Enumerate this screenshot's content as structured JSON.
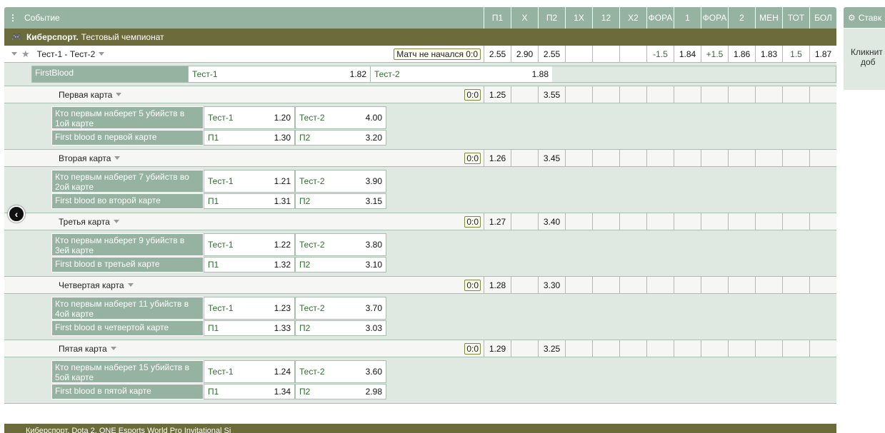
{
  "header": {
    "event_label": "Событие",
    "columns": [
      "П1",
      "X",
      "П2",
      "1X",
      "12",
      "X2",
      "ФОРА",
      "1",
      "ФОРА",
      "2",
      "МЕН",
      "ТОТ",
      "БОЛ"
    ]
  },
  "sport": {
    "name": "Киберспорт.",
    "championship": "Тестовый чемпионат"
  },
  "match": {
    "title": "Тест-1 - Тест-2",
    "status": "Матч не начался 0:0",
    "odds": [
      "2.55",
      "2.90",
      "2.55",
      "",
      "",
      "",
      "-1.5",
      "1.84",
      "+1.5",
      "1.86",
      "1.83",
      "1.5",
      "1.87"
    ]
  },
  "firstblood": {
    "name": "FirstBlood",
    "t1": "Тест-1",
    "t1_odd": "1.82",
    "t2": "Тест-2",
    "t2_odd": "1.88"
  },
  "maps": [
    {
      "title": "Первая карта",
      "score": "0:0",
      "p1": "1.25",
      "p2": "3.55",
      "kill_market": "Кто первым наберет 5 убийств в 1ой карте",
      "k_t1": "Тест-1",
      "k_t1_odd": "1.20",
      "k_t2": "Тест-2",
      "k_t2_odd": "4.00",
      "fb_market": "First blood в первой карте",
      "fb_p1": "П1",
      "fb_p1_odd": "1.30",
      "fb_p2": "П2",
      "fb_p2_odd": "3.20"
    },
    {
      "title": "Вторая карта",
      "score": "0:0",
      "p1": "1.26",
      "p2": "3.45",
      "kill_market": "Кто первым наберет 7 убийств во 2ой карте",
      "k_t1": "Тест-1",
      "k_t1_odd": "1.21",
      "k_t2": "Тест-2",
      "k_t2_odd": "3.90",
      "fb_market": "First blood во второй карте",
      "fb_p1": "П1",
      "fb_p1_odd": "1.31",
      "fb_p2": "П2",
      "fb_p2_odd": "3.15"
    },
    {
      "title": "Третья карта",
      "score": "0:0",
      "p1": "1.27",
      "p2": "3.40",
      "kill_market": "Кто первым наберет 9 убийств в 3ей карте",
      "k_t1": "Тест-1",
      "k_t1_odd": "1.22",
      "k_t2": "Тест-2",
      "k_t2_odd": "3.80",
      "fb_market": "First blood в третьей карте",
      "fb_p1": "П1",
      "fb_p1_odd": "1.32",
      "fb_p2": "П2",
      "fb_p2_odd": "3.10"
    },
    {
      "title": "Четвертая карта",
      "score": "0:0",
      "p1": "1.28",
      "p2": "3.30",
      "kill_market": "Кто первым наберет 11 убийств в 4ой карте",
      "k_t1": "Тест-1",
      "k_t1_odd": "1.23",
      "k_t2": "Тест-2",
      "k_t2_odd": "3.70",
      "fb_market": "First blood в четвертой карте",
      "fb_p1": "П1",
      "fb_p1_odd": "1.33",
      "fb_p2": "П2",
      "fb_p2_odd": "3.03"
    },
    {
      "title": "Пятая карта",
      "score": "0:0",
      "p1": "1.29",
      "p2": "3.25",
      "kill_market": "Кто первым наберет 15 убийств в 5ой карте",
      "k_t1": "Тест-1",
      "k_t1_odd": "1.24",
      "k_t2": "Тест-2",
      "k_t2_odd": "3.60",
      "fb_market": "First blood в пятой карте",
      "fb_p1": "П1",
      "fb_p1_odd": "1.34",
      "fb_p2": "П2",
      "fb_p2_odd": "2.98"
    }
  ],
  "right_panel": {
    "title": "Ставк",
    "body_line1": "Кликнит",
    "body_line2": "доб"
  },
  "bottom_partial": "Киберспорт. Dota 2. ONE Esports World Pro Invitational Si",
  "icons": {
    "menu": "menu-dots-icon",
    "gamepad": "gamepad-icon",
    "star": "star-icon",
    "gear": "gear-icon",
    "back": "chevron-left-icon"
  },
  "colors": {
    "header_green": "#96b2a0",
    "sport_olive": "#6b6b3b",
    "subpanel": "#dfe8e1",
    "odd_green": "#2e6e2e"
  }
}
